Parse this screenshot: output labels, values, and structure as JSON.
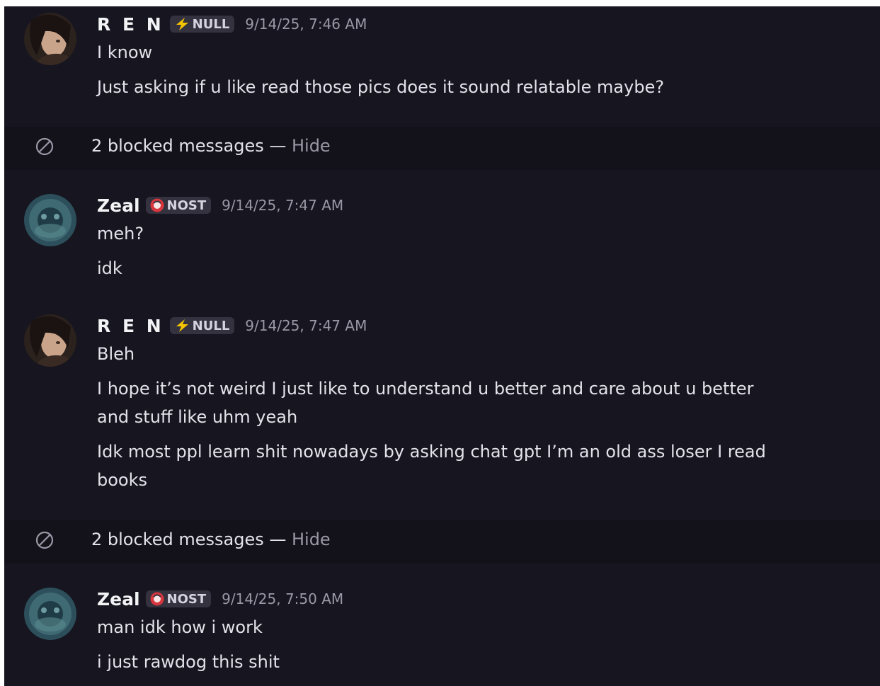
{
  "messages": [
    {
      "author": "R E N",
      "tag": "NULL",
      "tag_icon": "lightning-icon",
      "timestamp": "9/14/25, 7:46 AM",
      "lines": [
        "I know",
        "Just asking if u like read those pics does it sound relatable maybe?"
      ]
    },
    {
      "author": "Zeal",
      "tag": "NOST",
      "tag_icon": "red-ring-icon",
      "timestamp": "9/14/25, 7:47 AM",
      "lines": [
        "meh?",
        "idk"
      ]
    },
    {
      "author": "R E N",
      "tag": "NULL",
      "tag_icon": "lightning-icon",
      "timestamp": "9/14/25, 7:47 AM",
      "lines": [
        "Bleh",
        "I hope it’s not weird I just like to understand u better and care about u better",
        "and stuff like uhm yeah",
        "Idk most ppl learn shit nowadays by asking chat gpt I’m an old ass loser I read",
        "books"
      ]
    },
    {
      "author": "Zeal",
      "tag": "NOST",
      "tag_icon": "red-ring-icon",
      "timestamp": "9/14/25, 7:50 AM",
      "lines": [
        "man idk how i work",
        "i just rawdog this shit"
      ]
    }
  ],
  "blocked": [
    {
      "text": "2 blocked messages — ",
      "action": "Hide",
      "icon": "blocked-icon"
    },
    {
      "text": "2 blocked messages — ",
      "action": "Hide",
      "icon": "blocked-icon"
    }
  ],
  "colors": {
    "background": "#17151f",
    "blocked_background": "#131119",
    "text": "#e3e2ea",
    "muted": "#9a98a6",
    "lightning": "#f5c400",
    "nost_red": "#d8363e"
  }
}
